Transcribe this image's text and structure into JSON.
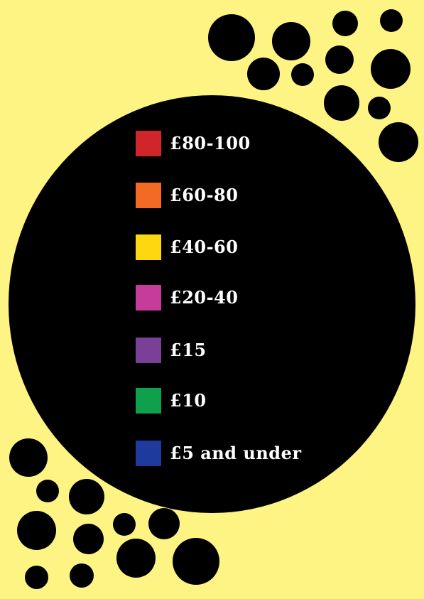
{
  "colors": {
    "background": "#FEF483",
    "circles": "#000000",
    "label_text": "#FFFFFF"
  },
  "legend": {
    "items": [
      {
        "label": "£80-100",
        "color": "#D0262B"
      },
      {
        "label": "£60-80",
        "color": "#F26A24"
      },
      {
        "label": "£40-60",
        "color": "#FFD711"
      },
      {
        "label": "£20-40",
        "color": "#C53C9A"
      },
      {
        "label": "£15",
        "color": "#7A3F97"
      },
      {
        "label": "£10",
        "color": "#0FA04C"
      },
      {
        "label": "£5 and under",
        "color": "#1E3A9C"
      }
    ]
  }
}
